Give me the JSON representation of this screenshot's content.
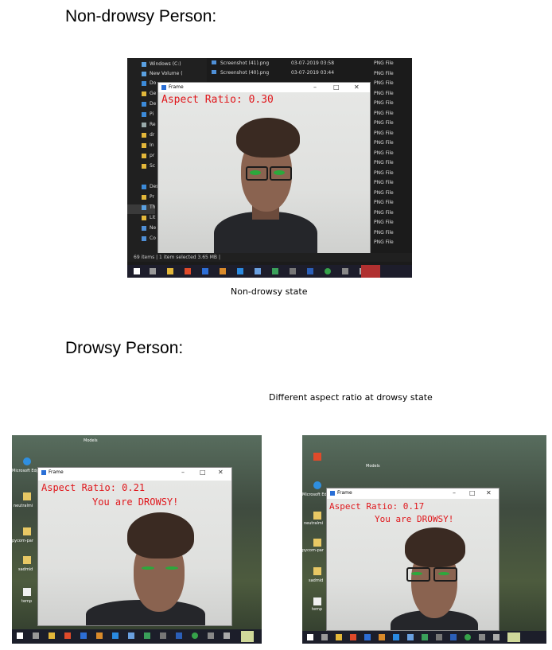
{
  "headings": {
    "non_drowsy": "Non-drowsy Person:",
    "drowsy": "Drowsy Person:"
  },
  "captions": {
    "non_drowsy_state": "Non-drowsy state",
    "drowsy_state": "Different aspect ratio at drowsy state"
  },
  "screenshot1": {
    "nav": [
      "Windows (C:)",
      "New Volume (",
      "Do",
      "Ge",
      "De",
      "Pi",
      "Re",
      "dr",
      "In",
      "pr",
      "Sc",
      "Des",
      "Pr",
      "Th",
      "Lit",
      "Ne",
      "Co"
    ],
    "files": [
      {
        "name": "Screenshot (41).png",
        "date": "03-07-2019 03:58"
      },
      {
        "name": "Screenshot (40).png",
        "date": "03-07-2019 03:44"
      }
    ],
    "file_type": "PNG File",
    "status": "69 items  |  1 item selected  3.65 MB  |",
    "frame_title": "Frame",
    "aspect_ratio": "Aspect Ratio: 0.30",
    "colors": {
      "text": "#e0161b",
      "eyes": "#2ca83c"
    }
  },
  "screenshot2": {
    "frame_title": "Frame",
    "aspect_ratio": "Aspect Ratio: 0.21",
    "alert": "You are DROWSY!",
    "desktop_labels": [
      "Models",
      "Microsoft Edge De",
      "neutralmi",
      "pycom-par",
      "sadmid",
      "temp"
    ]
  },
  "screenshot3": {
    "frame_title": "Frame",
    "aspect_ratio": "Aspect Ratio: 0.17",
    "alert": "You are DROWSY!",
    "desktop_labels": [
      "Models",
      "Microsoft Edge De",
      "neutralmi",
      "pycom-par",
      "sadmid",
      "temp"
    ]
  }
}
